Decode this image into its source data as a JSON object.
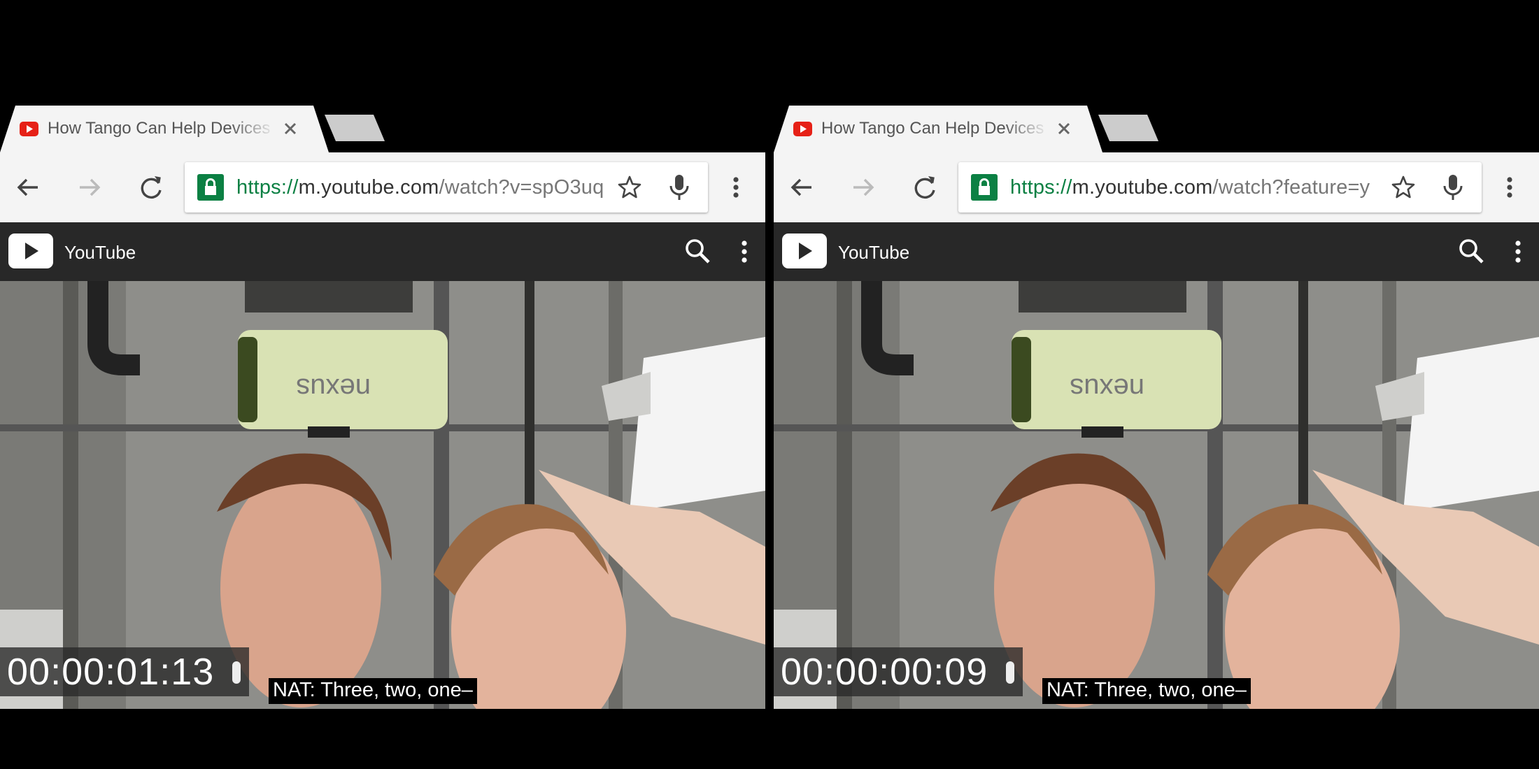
{
  "left": {
    "tab": {
      "title": "How Tango Can Help Devices"
    },
    "omnibox": {
      "scheme": "https://",
      "host": "m.youtube.com",
      "path": "/watch?v=spO3uq"
    },
    "youtube": {
      "title": "YouTube"
    },
    "video": {
      "timecode": "00:00:01:13",
      "caption": "NAT: Three, two, one–",
      "phone_text": "nexus"
    }
  },
  "right": {
    "tab": {
      "title": "How Tango Can Help Devices"
    },
    "omnibox": {
      "scheme": "https://",
      "host": "m.youtube.com",
      "path": "/watch?feature=y"
    },
    "youtube": {
      "title": "YouTube"
    },
    "video": {
      "timecode": "00:00:00:09",
      "caption": "NAT: Three, two, one–",
      "phone_text": "nexus"
    }
  },
  "icons": {
    "tab_favicon": "youtube-favicon-icon",
    "tab_close": "close-icon",
    "back": "arrow-back-icon",
    "forward": "arrow-forward-icon",
    "reload": "reload-icon",
    "lock": "lock-icon",
    "bookmark": "star-icon",
    "voice": "microphone-icon",
    "menu": "more-vert-icon",
    "search": "search-icon"
  },
  "colors": {
    "youtube_red": "#e62117",
    "secure_green": "#0b8043",
    "youtube_bar": "#282828",
    "toolbar": "#f4f4f4"
  }
}
